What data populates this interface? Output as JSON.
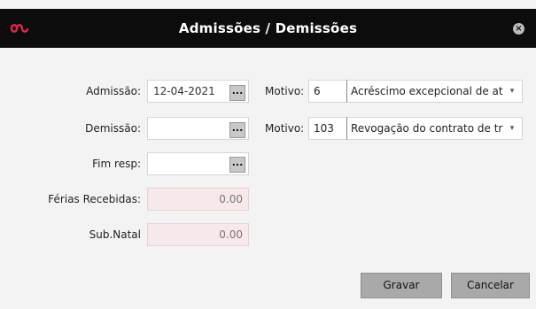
{
  "dialog": {
    "title": "Admissões / Demissões",
    "close_glyph": "×",
    "logo_icon": "infinity-logo-icon"
  },
  "form": {
    "admissao": {
      "label": "Admissão:",
      "value": "12-04-2021",
      "button": "..."
    },
    "demissao": {
      "label": "Demissão:",
      "value": "",
      "button": "..."
    },
    "fim_resp": {
      "label": "Fim resp:",
      "value": "",
      "button": "..."
    },
    "ferias": {
      "label": "Férias Recebidas:",
      "value": "0.00"
    },
    "sub_natal": {
      "label": "Sub.Natal",
      "value": "0.00"
    }
  },
  "motivo_admissao": {
    "label": "Motivo:",
    "code": "6",
    "text": "Acréscimo excepcional de at",
    "caret": "▾"
  },
  "motivo_demissao": {
    "label": "Motivo:",
    "code": "103",
    "text": "Revogação do contrato de tr",
    "caret": "▾"
  },
  "buttons": {
    "gravar": "Gravar",
    "cancelar": "Cancelar"
  },
  "colors": {
    "titlebar": "#0c0c0c",
    "logo": "#e0264a",
    "readonly_bg": "#f7e9e9",
    "button": "#a9a9a9"
  }
}
